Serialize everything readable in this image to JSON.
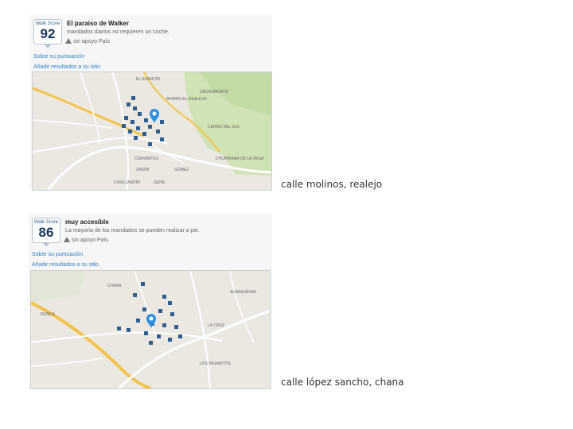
{
  "widgets": [
    {
      "badge_label": "Walk Score",
      "score": "92",
      "title": "El paraiso de Walker",
      "description": "mandados diarios no requieren un coche.",
      "support": "sin apoyo País",
      "link_score": "Sobre su puntuación",
      "link_add": "Añadir resultados a su sitio",
      "map_labels": [
        "EL ALBAICÍN",
        "SACROMONTE",
        "BARRIO EL REALEJO",
        "CERVANTES",
        "ZAIDÍN",
        "GÓMEZ",
        "CASA JARDÍN",
        "GENIL",
        "CHURRIANA DE LA VEGA",
        "CERRO DEL SOL"
      ],
      "caption": "calle molinos, realejo"
    },
    {
      "badge_label": "Walk Score",
      "score": "86",
      "title": "muy accesible",
      "description": "La mayoría de los mandados se pueden realizar a pie.",
      "support": "sin apoyo País",
      "link_score": "Sobre su puntuación",
      "link_add": "Añadir resultados a su sitio",
      "map_labels": [
        "CHANA",
        "LA CRUZ",
        "LOS PAJARITOS",
        "ALMANJÁYAR",
        "RONDA"
      ],
      "caption": "calle lópez sancho, chana"
    }
  ],
  "colors": {
    "badge_number": "#16365a",
    "link": "#2f82c6",
    "marker": "#2f8fe0"
  }
}
